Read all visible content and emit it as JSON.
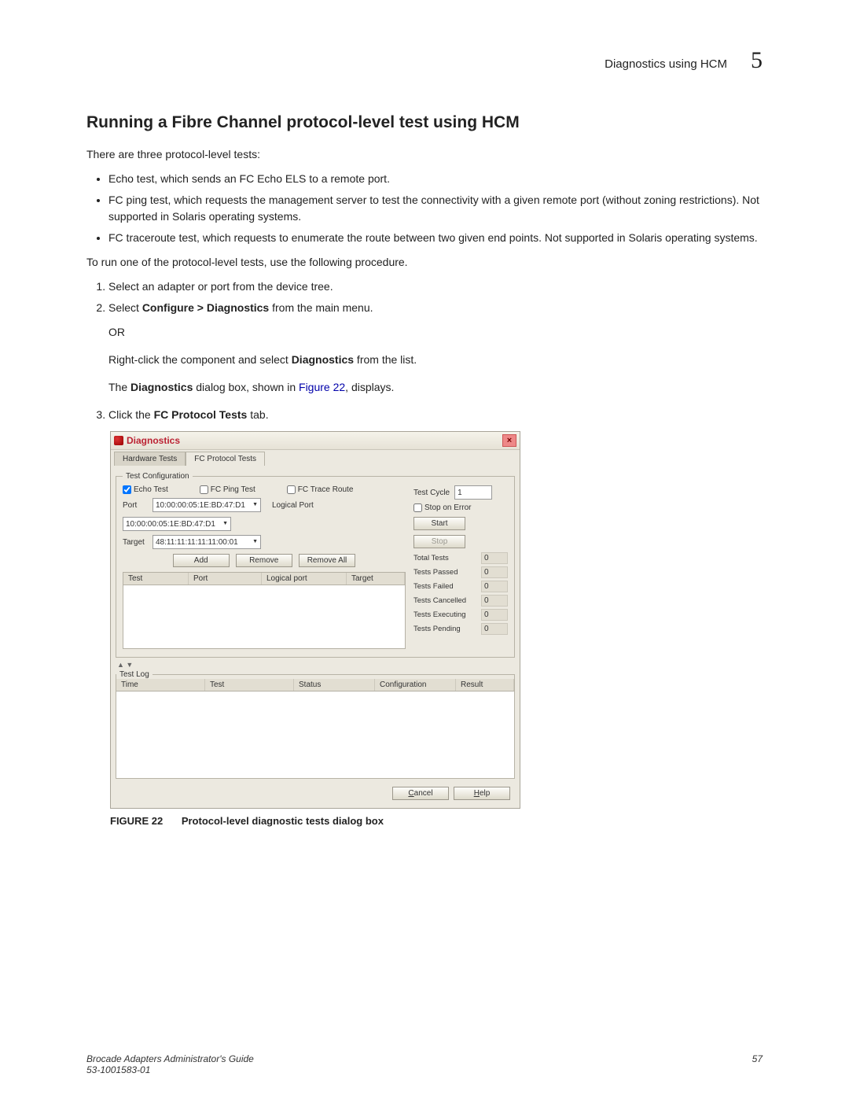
{
  "header": {
    "title": "Diagnostics using HCM",
    "chapter": "5"
  },
  "section_title": "Running a Fibre Channel protocol-level test using HCM",
  "intro": "There are three protocol-level tests:",
  "bullets": [
    "Echo test, which sends an FC Echo ELS to a remote port.",
    "FC ping test, which requests the management server to test the connectivity with a given remote port (without zoning restrictions). Not supported in Solaris operating systems.",
    "FC traceroute test, which requests to enumerate the route between two given end points. Not supported in Solaris operating systems."
  ],
  "procedure_intro": "To run one of the protocol-level tests, use the following procedure.",
  "steps": {
    "s1": "Select an adapter or port from the device tree.",
    "s2_pre": "Select ",
    "s2_bold": "Configure > Diagnostics",
    "s2_post": " from the main menu.",
    "s2_or": "OR",
    "s2_rc_pre": "Right-click the component and select ",
    "s2_rc_bold": "Diagnostics",
    "s2_rc_post": " from the list.",
    "s2_d_pre": "The ",
    "s2_d_bold": "Diagnostics",
    "s2_d_mid": " dialog box, shown in ",
    "s2_d_link": "Figure 22",
    "s2_d_post": ", displays.",
    "s3_pre": "Click the ",
    "s3_bold": "FC Protocol Tests",
    "s3_post": " tab."
  },
  "dialog": {
    "title": "Diagnostics",
    "tabs": {
      "hw": "Hardware Tests",
      "fc": "FC Protocol Tests"
    },
    "group_config": "Test Configuration",
    "checks": {
      "echo": "Echo Test",
      "ping": "FC Ping Test",
      "trace": "FC Trace Route"
    },
    "labels": {
      "port": "Port",
      "lport": "Logical Port",
      "target": "Target",
      "testcycle": "Test Cycle",
      "stoperr": "Stop on Error"
    },
    "values": {
      "port": "10:00:00:05:1E:BD:47:D1",
      "lport": "10:00:00:05:1E:BD:47:D1",
      "target": "48:11:11:11:11:11:00:01",
      "testcycle": "1"
    },
    "buttons": {
      "add": "Add",
      "remove": "Remove",
      "removeall": "Remove All",
      "start": "Start",
      "stop": "Stop",
      "cancel": "Cancel",
      "help": "Help"
    },
    "grid_cols": {
      "test": "Test",
      "port": "Port",
      "lport": "Logical port",
      "target": "Target"
    },
    "stats": {
      "total": {
        "label": "Total Tests",
        "value": "0"
      },
      "passed": {
        "label": "Tests Passed",
        "value": "0"
      },
      "failed": {
        "label": "Tests Failed",
        "value": "0"
      },
      "cancelled": {
        "label": "Tests Cancelled",
        "value": "0"
      },
      "executing": {
        "label": "Tests Executing",
        "value": "0"
      },
      "pending": {
        "label": "Tests Pending",
        "value": "0"
      }
    },
    "group_log": "Test Log",
    "log_cols": {
      "time": "Time",
      "test": "Test",
      "status": "Status",
      "config": "Configuration",
      "result": "Result"
    }
  },
  "figure": {
    "label": "FIGURE 22",
    "caption": "Protocol-level diagnostic tests dialog box"
  },
  "footer": {
    "guide": "Brocade Adapters Administrator's Guide",
    "docnum": "53-1001583-01",
    "pagenum": "57"
  }
}
